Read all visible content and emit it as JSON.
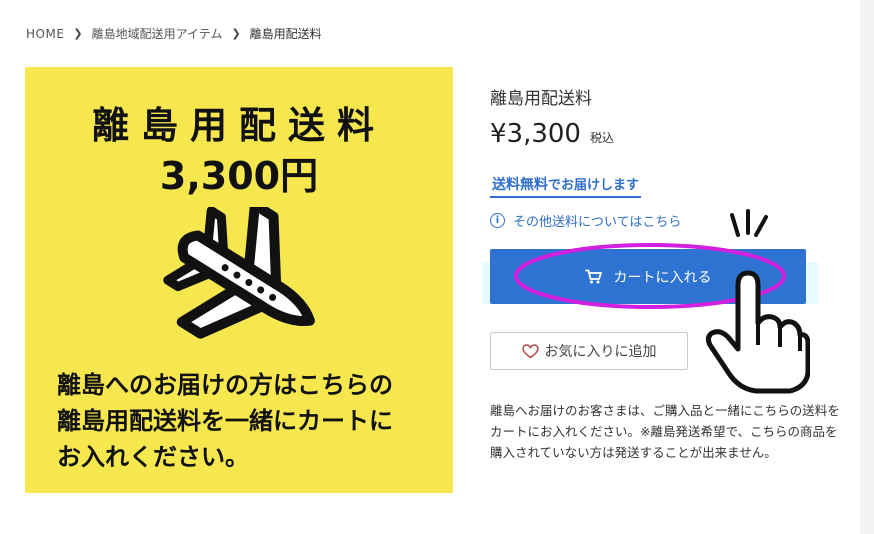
{
  "breadcrumb": {
    "home": "HOME",
    "category": "離島地域配送用アイテム",
    "current": "離島用配送料"
  },
  "product_image": {
    "title": "離島用配送料",
    "price": "3,300円",
    "caption_lines": [
      "離島へのお届けの方はこちらの",
      "離島用配送料を一緒にカートに",
      "お入れください。"
    ],
    "background_color": "#f6e74f",
    "icon": "airplane-icon"
  },
  "product": {
    "name": "離島用配送料",
    "price": "¥3,300",
    "tax_label": "税込",
    "free_shipping_strong": "送料無料",
    "free_shipping_rest": "でお届けします",
    "other_shipping_link": "その他送料についてはこちら",
    "add_to_cart_label": "カートに入れる",
    "favorite_label": "お気に入りに追加",
    "description": "離島へお届けのお客さまは、ご購入品と一緒にこちらの送料をカートにお入れください。※離島発送希望で、こちらの商品を購入されていない方は発送することが出来ません。"
  },
  "colors": {
    "accent": "#2f73d2",
    "link": "#2f6fce",
    "annotation": "#d21fe0"
  },
  "icons": {
    "breadcrumb_sep": "chevron-right-icon",
    "info": "info-icon",
    "cart": "cart-icon",
    "favorite": "heart-icon",
    "pointer": "pointing-hand-icon"
  }
}
